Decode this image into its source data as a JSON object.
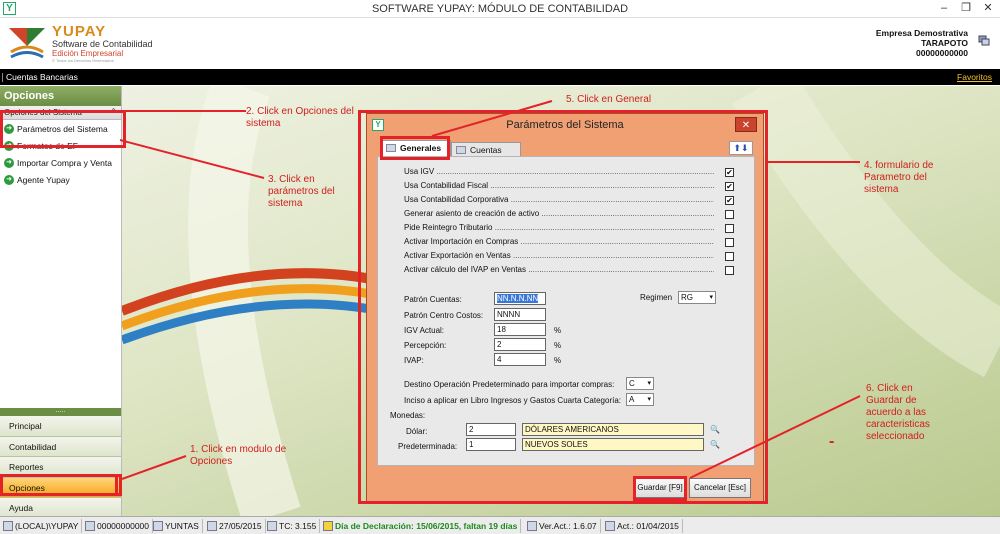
{
  "window": {
    "title": "SOFTWARE YUPAY: MÓDULO DE CONTABILIDAD",
    "minimize": "–",
    "restore": "❐",
    "close": "✕"
  },
  "header": {
    "logo_name": "YUPAY",
    "logo_sub": "Software de Contabilidad",
    "logo_edition": "Edición Empresarial",
    "logo_tiny": "© Todos los Derechos Reservados",
    "company_name": "Empresa Demostrativa",
    "company_city": "TARAPOTO",
    "company_ruc": "00000000000"
  },
  "navbar": {
    "breadcrumb": "Cuentas Bancarias",
    "favorites": "Favoritos"
  },
  "sidebar": {
    "title": "Opciones",
    "section": "Opciones del Sistema",
    "items": [
      {
        "label": "Parámetros del Sistema"
      },
      {
        "label": "Formatos de EF"
      },
      {
        "label": "Importar Compra y Venta"
      },
      {
        "label": "Agente Yupay"
      }
    ],
    "modules": [
      {
        "label": "Principal"
      },
      {
        "label": "Contabilidad"
      },
      {
        "label": "Reportes"
      },
      {
        "label": "Opciones"
      },
      {
        "label": "Ayuda"
      }
    ]
  },
  "dialog": {
    "title": "Parámetros del Sistema",
    "close": "✕",
    "tabs": [
      {
        "label": "Generales"
      },
      {
        "label": "Cuentas"
      }
    ],
    "arrows": "⬆⬇",
    "checks": [
      {
        "label": "Usa IGV",
        "checked": "✔"
      },
      {
        "label": "Usa Contabilidad Fiscal",
        "checked": "✔"
      },
      {
        "label": "Usa Contabilidad Corporativa",
        "checked": "✔"
      },
      {
        "label": "Generar asiento de creación de activo",
        "checked": ""
      },
      {
        "label": "Pide Reintegro Tributario",
        "checked": ""
      },
      {
        "label": "Activar Importación en Compras",
        "checked": ""
      },
      {
        "label": "Activar Exportación en Ventas",
        "checked": ""
      },
      {
        "label": "Activar cálculo del IVAP  en Ventas",
        "checked": ""
      }
    ],
    "fields": {
      "patron_cuentas_label": "Patrón Cuentas:",
      "patron_cuentas_value": "NN.N.N.NN",
      "regimen_label": "Regimen",
      "regimen_value": "RG",
      "patron_cc_label": "Patrón Centro Costos:",
      "patron_cc_value": "NNNN",
      "igv_label": "IGV Actual:",
      "igv_value": "18",
      "percepcion_label": "Percepción:",
      "percepcion_value": "2",
      "ivap_label": "IVAP:",
      "ivap_value": "4",
      "pct": "%",
      "destino_label": "Destino Operación Predeterminado para importar compras:",
      "destino_value": "C",
      "inciso_label": "Inciso a aplicar en Libro Ingresos y Gastos Cuarta Categoría:",
      "inciso_value": "A",
      "monedas_label": "Monedas:",
      "dolar_label": "Dólar:",
      "dolar_code": "2",
      "dolar_name": "DÓLARES AMERICANOS",
      "pred_label": "Predeterminada:",
      "pred_code": "1",
      "pred_name": "NUEVOS SOLES"
    },
    "save_button": "Guardar [F9]",
    "cancel_button": "Cancelar [Esc]"
  },
  "statusbar": {
    "items": [
      "(LOCAL)\\YUPAY",
      "00000000000",
      "YUNTAS",
      "27/05/2015",
      "TC: 3.155",
      "Día de Declaración: 15/06/2015, faltan 19 días",
      "Ver.Act.: 1.6.07",
      "Act.: 01/04/2015"
    ]
  },
  "annotations": {
    "n1": "1.  Click en modulo de Opciones",
    "n2": "2. Click en Opciones del sistema",
    "n3": "3. Click en parámetros del sistema",
    "n4": "4. formulario de Parametro del sistema",
    "n5": "5. Click en General",
    "n6": "6. Click en Guardar de acuerdo a las caracteristicas seleccionado",
    "dash": "-"
  },
  "colors": {
    "annotation_red": "#e3222a",
    "dialog_orange": "#f0a073",
    "active_module": "#f3a316",
    "sidebar_green": "#6b8d44"
  }
}
